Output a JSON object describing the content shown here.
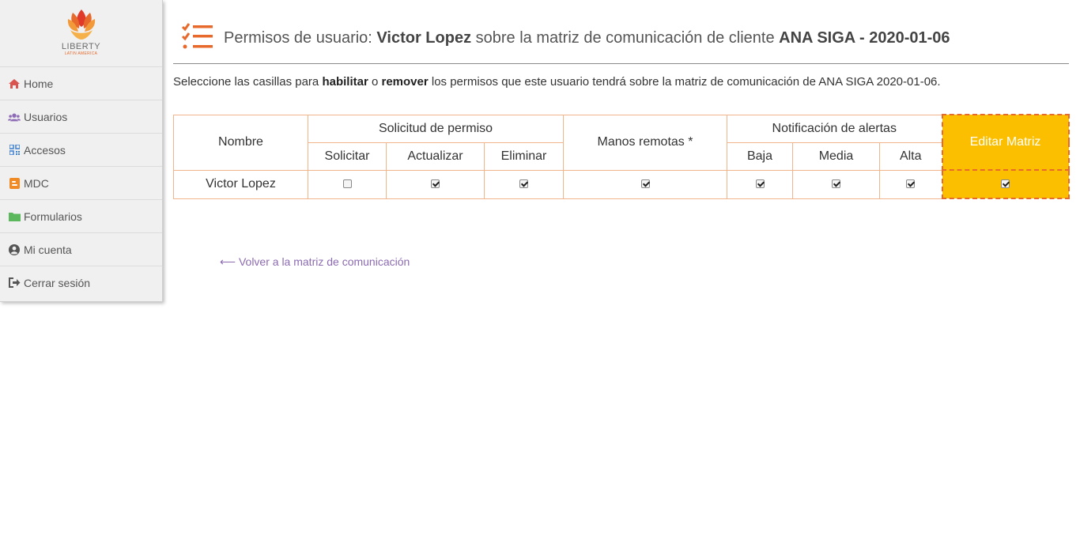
{
  "brand": {
    "name": "LIBERTY",
    "tagline": "LATIN AMERICA",
    "accent": "#e8692c"
  },
  "nav": {
    "items": [
      {
        "label": "Home",
        "icon": "home-icon",
        "color": "#d9534f"
      },
      {
        "label": "Usuarios",
        "icon": "users-icon",
        "color": "#8e6bb5"
      },
      {
        "label": "Accesos",
        "icon": "qrcode-icon",
        "color": "#3b7fd0"
      },
      {
        "label": "MDC",
        "icon": "blogger-icon",
        "color": "#f08a24"
      },
      {
        "label": "Formularios",
        "icon": "folder-icon",
        "color": "#5cb85c"
      },
      {
        "label": "Mi cuenta",
        "icon": "user-circle-icon",
        "color": "#555555"
      },
      {
        "label": "Cerrar sesión",
        "icon": "sign-out-icon",
        "color": "#555555"
      }
    ]
  },
  "header": {
    "prefix": "Permisos de usuario: ",
    "user": "Victor Lopez",
    "middle": " sobre la matriz de comunicación de cliente ",
    "matrix": "ANA SIGA - 2020-01-06"
  },
  "instructions": {
    "part1": "Seleccione las casillas para ",
    "habilitar": "habilitar",
    "part2": " o ",
    "remover": "remover",
    "part3": " los permisos que este usuario tendrá sobre la matriz de comunicación de ANA SIGA 2020-01-06."
  },
  "table": {
    "col_nombre": "Nombre",
    "group_solicitud": "Solicitud de permiso",
    "solicitar": "Solicitar",
    "actualizar": "Actualizar",
    "eliminar": "Eliminar",
    "manos_remotas": "Manos remotas *",
    "group_notificacion": "Notificación de alertas",
    "baja": "Baja",
    "media": "Media",
    "alta": "Alta",
    "editar_matriz": "Editar Matriz",
    "rows": [
      {
        "nombre": "Victor Lopez",
        "solicitar": false,
        "actualizar": true,
        "eliminar": true,
        "manos_remotas": true,
        "baja": true,
        "media": true,
        "alta": true,
        "editar_matriz": true
      }
    ]
  },
  "back_link": {
    "arrow": "⟵",
    "label": "Volver a la matriz de comunicación"
  }
}
